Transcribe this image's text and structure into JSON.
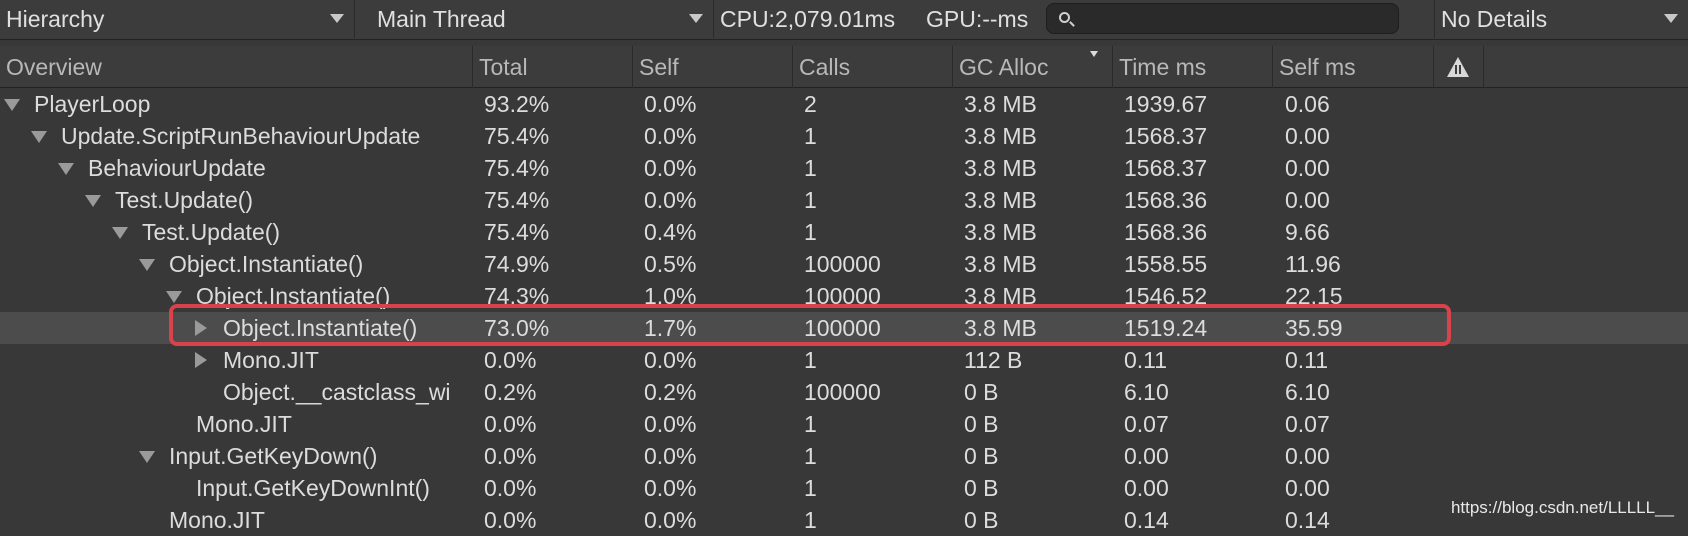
{
  "toolbar": {
    "view_mode": "Hierarchy",
    "thread": "Main Thread",
    "cpu_label": "CPU:2,079.01ms",
    "gpu_label": "GPU:--ms",
    "search_placeholder": "",
    "details_mode": "No Details"
  },
  "columns": {
    "overview": "Overview",
    "total": "Total",
    "self": "Self",
    "calls": "Calls",
    "gc_alloc": "GC Alloc",
    "time_ms": "Time ms",
    "self_ms": "Self ms"
  },
  "rows": [
    {
      "name": "PlayerLoop",
      "depth": 0,
      "toggle": "expanded",
      "total": "93.2%",
      "self": "0.0%",
      "calls": "2",
      "gc": "3.8 MB",
      "time": "1939.67",
      "selfms": "0.06"
    },
    {
      "name": "Update.ScriptRunBehaviourUpdate",
      "depth": 1,
      "toggle": "expanded",
      "total": "75.4%",
      "self": "0.0%",
      "calls": "1",
      "gc": "3.8 MB",
      "time": "1568.37",
      "selfms": "0.00"
    },
    {
      "name": "BehaviourUpdate",
      "depth": 2,
      "toggle": "expanded",
      "total": "75.4%",
      "self": "0.0%",
      "calls": "1",
      "gc": "3.8 MB",
      "time": "1568.37",
      "selfms": "0.00"
    },
    {
      "name": "Test.Update()",
      "depth": 3,
      "toggle": "expanded",
      "total": "75.4%",
      "self": "0.0%",
      "calls": "1",
      "gc": "3.8 MB",
      "time": "1568.36",
      "selfms": "0.00"
    },
    {
      "name": "Test.Update()",
      "depth": 4,
      "toggle": "expanded",
      "total": "75.4%",
      "self": "0.4%",
      "calls": "1",
      "gc": "3.8 MB",
      "time": "1568.36",
      "selfms": "9.66"
    },
    {
      "name": "Object.Instantiate()",
      "depth": 5,
      "toggle": "expanded",
      "total": "74.9%",
      "self": "0.5%",
      "calls": "100000",
      "gc": "3.8 MB",
      "time": "1558.55",
      "selfms": "11.96"
    },
    {
      "name": "Object.Instantiate()",
      "depth": 6,
      "toggle": "expanded",
      "total": "74.3%",
      "self": "1.0%",
      "calls": "100000",
      "gc": "3.8 MB",
      "time": "1546.52",
      "selfms": "22.15"
    },
    {
      "name": "Object.Instantiate()",
      "depth": 7,
      "toggle": "collapsed",
      "selected": true,
      "total": "73.0%",
      "self": "1.7%",
      "calls": "100000",
      "gc": "3.8 MB",
      "time": "1519.24",
      "selfms": "35.59"
    },
    {
      "name": "Mono.JIT",
      "depth": 7,
      "toggle": "collapsed",
      "total": "0.0%",
      "self": "0.0%",
      "calls": "1",
      "gc": "112 B",
      "time": "0.11",
      "selfms": "0.11"
    },
    {
      "name": "Object.__castclass_wi",
      "depth": 7,
      "toggle": "none",
      "total": "0.2%",
      "self": "0.2%",
      "calls": "100000",
      "gc": "0 B",
      "time": "6.10",
      "selfms": "6.10"
    },
    {
      "name": "Mono.JIT",
      "depth": 6,
      "toggle": "none",
      "total": "0.0%",
      "self": "0.0%",
      "calls": "1",
      "gc": "0 B",
      "time": "0.07",
      "selfms": "0.07"
    },
    {
      "name": "Input.GetKeyDown()",
      "depth": 5,
      "toggle": "expanded",
      "total": "0.0%",
      "self": "0.0%",
      "calls": "1",
      "gc": "0 B",
      "time": "0.00",
      "selfms": "0.00"
    },
    {
      "name": "Input.GetKeyDownInt()",
      "depth": 6,
      "toggle": "none",
      "total": "0.0%",
      "self": "0.0%",
      "calls": "1",
      "gc": "0 B",
      "time": "0.00",
      "selfms": "0.00"
    },
    {
      "name": "Mono.JIT",
      "depth": 5,
      "toggle": "none",
      "total": "0.0%",
      "self": "0.0%",
      "calls": "1",
      "gc": "0 B",
      "time": "0.14",
      "selfms": "0.14"
    }
  ],
  "watermark": "https://blog.csdn.net/LLLLL__",
  "colors": {
    "background": "#383838",
    "highlight_border": "#d8434b",
    "selected_row": "#4c4c4c"
  },
  "icons": {
    "search": "search-icon",
    "warning": "warning-icon"
  }
}
